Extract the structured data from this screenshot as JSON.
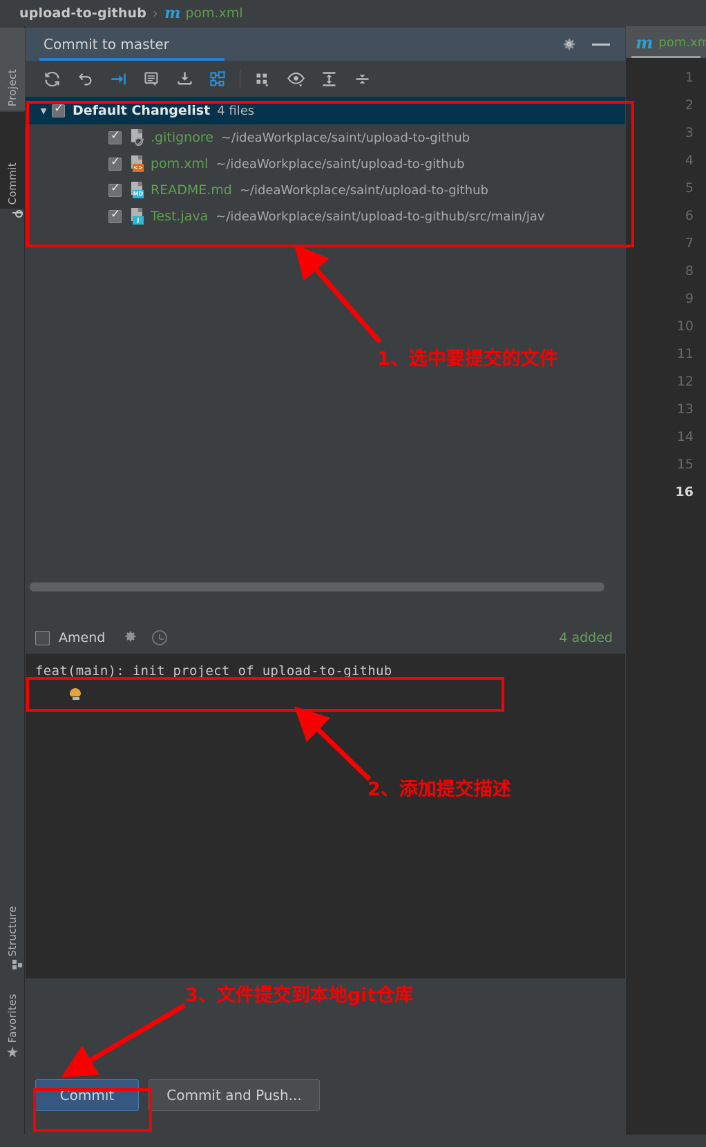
{
  "breadcrumb": {
    "project": "upload-to-github",
    "separator": "›",
    "file_icon": "m",
    "file": "pom.xml"
  },
  "left_strip": {
    "items": [
      {
        "label": "Project",
        "icon": "folder-icon"
      },
      {
        "label": "Commit",
        "icon": "commit-icon"
      },
      {
        "label": "Structure",
        "icon": "structure-icon"
      },
      {
        "label": "Favorites",
        "icon": "star-icon"
      }
    ]
  },
  "commit_window": {
    "title": "Commit to master",
    "header_actions": [
      {
        "name": "settings",
        "icon": "gear-icon"
      },
      {
        "name": "minimize",
        "icon": "minimize-icon"
      }
    ],
    "toolbar": [
      {
        "name": "refresh",
        "icon": "refresh-icon"
      },
      {
        "name": "rollback",
        "icon": "undo-icon"
      },
      {
        "name": "move-to-changelist",
        "icon": "arrow-into-icon"
      },
      {
        "name": "show-diff",
        "icon": "diff-note-icon"
      },
      {
        "name": "update-project",
        "icon": "download-icon"
      },
      {
        "name": "show-history",
        "icon": "branches-icon"
      },
      {
        "name": "group-by",
        "icon": "group-by-icon"
      },
      {
        "name": "preview-diff",
        "icon": "eye-icon"
      },
      {
        "name": "expand-all",
        "icon": "expand-all-icon"
      },
      {
        "name": "collapse-all",
        "icon": "collapse-all-icon"
      }
    ],
    "changelist": {
      "name": "Default Changelist",
      "count": "4 files",
      "checked": true,
      "expanded": true
    },
    "files": [
      {
        "name": ".gitignore",
        "path": "~/ideaWorkplace/saint/upload-to-github",
        "icon": "gitignore-file-icon",
        "badge": "",
        "checked": true
      },
      {
        "name": "pom.xml",
        "path": "~/ideaWorkplace/saint/upload-to-github",
        "icon": "xml-file-icon",
        "badge": "<>",
        "checked": true
      },
      {
        "name": "README.md",
        "path": "~/ideaWorkplace/saint/upload-to-github",
        "icon": "markdown-file-icon",
        "badge": "MD",
        "checked": true
      },
      {
        "name": "Test.java",
        "path": "~/ideaWorkplace/saint/upload-to-github/src/main/jav",
        "icon": "java-file-icon",
        "badge": "J",
        "checked": true
      }
    ],
    "amend": {
      "label": "Amend",
      "checked": false,
      "icons": [
        {
          "name": "commit-options",
          "icon": "gear-icon"
        },
        {
          "name": "commit-history",
          "icon": "clock-icon"
        }
      ]
    },
    "added_status": "4 added",
    "commit_message": "feat(main): init project of upload-to-github",
    "buttons": {
      "commit": "Commit",
      "commit_and_push": "Commit and Push..."
    }
  },
  "editor_pane": {
    "tab_icon": "m",
    "tab_file": "pom.xml",
    "line_numbers": [
      "1",
      "2",
      "3",
      "4",
      "5",
      "6",
      "7",
      "8",
      "9",
      "10",
      "11",
      "12",
      "13",
      "14",
      "15",
      "16"
    ],
    "current_line": "16"
  },
  "annotations": [
    {
      "id": "1",
      "text": "1、选中要提交的文件"
    },
    {
      "id": "2",
      "text": "2、添加提交描述"
    },
    {
      "id": "3",
      "text": "3、文件提交到本地git仓库"
    }
  ],
  "colors": {
    "annotation_red": "#f90000",
    "accent_blue": "#2a7fd4",
    "file_green": "#5fa050",
    "selection_navy": "#05334b"
  }
}
